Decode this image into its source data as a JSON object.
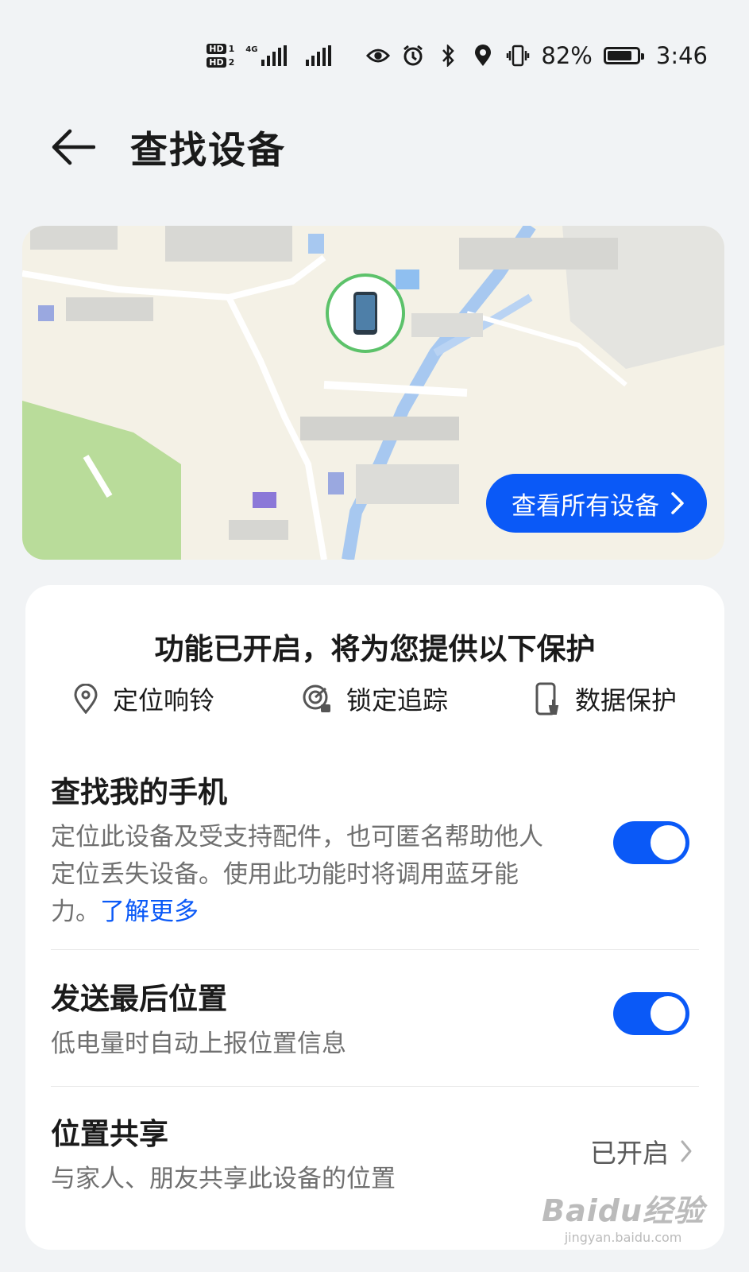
{
  "status_bar": {
    "hd1": "HD",
    "hd1_num": "1",
    "hd2": "HD",
    "hd2_num": "2",
    "network": "4G",
    "battery": "82%",
    "battery_level": 0.82,
    "time": "3:46",
    "icons": [
      "eye-icon",
      "alarm-icon",
      "bluetooth-icon",
      "location-icon",
      "vibrate-icon",
      "battery-icon"
    ]
  },
  "header": {
    "title": "查找设备"
  },
  "map": {
    "view_all_label": "查看所有设备"
  },
  "protection": {
    "title": "功能已开启，将为您提供以下保护",
    "features": [
      {
        "label": "定位响铃",
        "icon": "location-pin-icon"
      },
      {
        "label": "锁定追踪",
        "icon": "lock-track-icon"
      },
      {
        "label": "数据保护",
        "icon": "phone-clean-icon"
      }
    ]
  },
  "settings": {
    "find_phone": {
      "title": "查找我的手机",
      "desc": "定位此设备及受支持配件，也可匿名帮助他人定位丢失设备。使用此功能时将调用蓝牙能力。",
      "link": "了解更多",
      "enabled": true
    },
    "last_location": {
      "title": "发送最后位置",
      "desc": "低电量时自动上报位置信息",
      "enabled": true
    },
    "location_sharing": {
      "title": "位置共享",
      "desc": "与家人、朋友共享此设备的位置",
      "value": "已开启"
    }
  },
  "watermark": {
    "main": "Baidu经验",
    "sub": "jingyan.baidu.com"
  },
  "colors": {
    "accent": "#0a59f7",
    "background": "#f1f3f5",
    "card": "#ffffff",
    "map_green": "#b9dc9a",
    "map_blue": "#a7c8f0"
  }
}
